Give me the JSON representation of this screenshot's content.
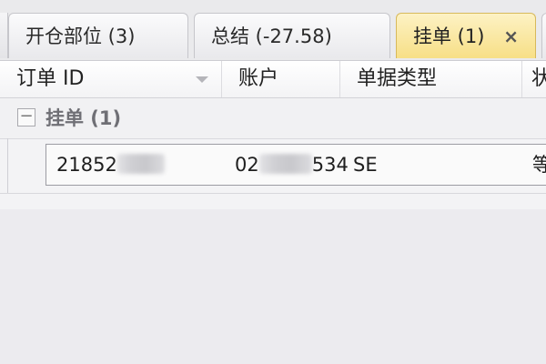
{
  "tabs": [
    {
      "label": "开仓部位 (3)",
      "active": false
    },
    {
      "label": "总结 (-27.58)",
      "active": false
    },
    {
      "label": "挂单 (1)",
      "active": true,
      "close": "×"
    }
  ],
  "columns": {
    "order_id": "订单 ID",
    "account": "账户",
    "doc_type": "单据类型",
    "status_partial": "状"
  },
  "group": {
    "expander": "−",
    "label": "挂单 (1)"
  },
  "rows": [
    {
      "order_prefix": "21852",
      "account_prefix": "02",
      "account_suffix": "534",
      "type": "SE",
      "status_partial": "等"
    }
  ],
  "colors": {
    "active_tab": "#f7df86",
    "background": "#ecebef"
  }
}
